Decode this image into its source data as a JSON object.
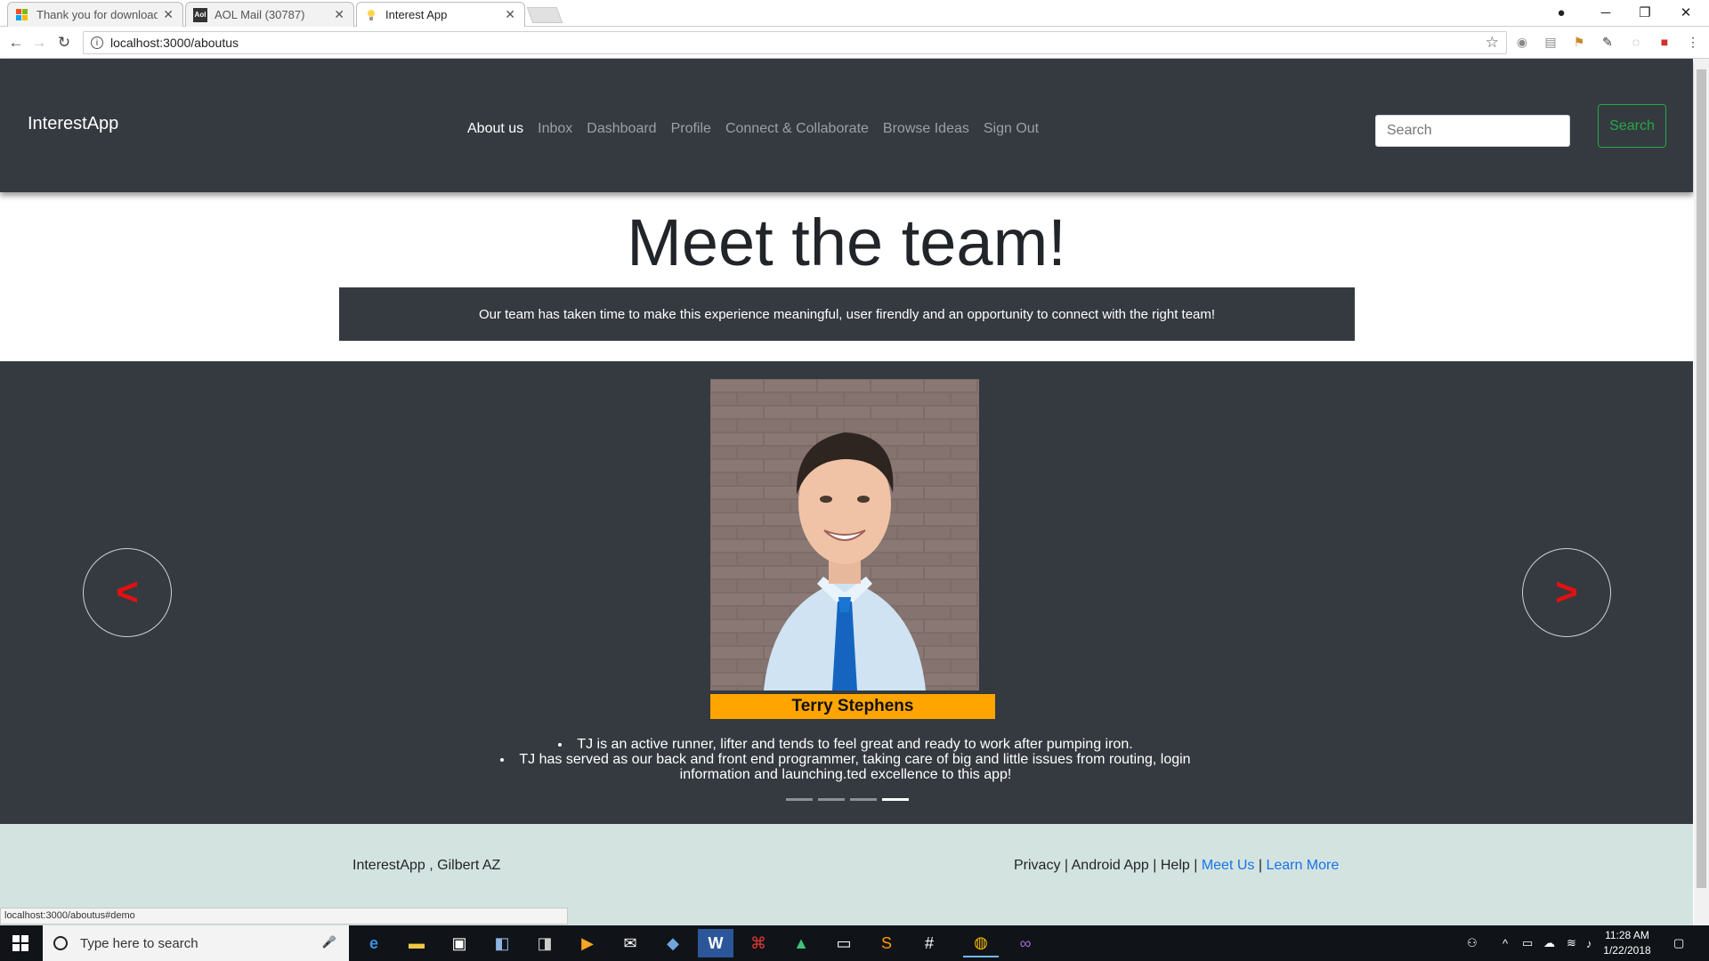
{
  "browser": {
    "tabs": [
      {
        "title": "Thank you for download",
        "active": false
      },
      {
        "title": "AOL Mail (30787)",
        "active": false
      },
      {
        "title": "Interest App",
        "active": true
      }
    ],
    "url": "localhost:3000/aboutus",
    "status_url": "localhost:3000/aboutus#demo",
    "icons": {
      "back": "back-arrow-icon",
      "forward": "forward-arrow-icon",
      "reload": "reload-icon",
      "star": "bookmark-star-icon"
    }
  },
  "navbar": {
    "brand": "InterestApp",
    "links": [
      {
        "label": "About us",
        "active": true
      },
      {
        "label": "Inbox",
        "active": false
      },
      {
        "label": "Dashboard",
        "active": false
      },
      {
        "label": "Profile",
        "active": false
      },
      {
        "label": "Connect & Collaborate",
        "active": false
      },
      {
        "label": "Browse Ideas",
        "active": false
      },
      {
        "label": "Sign Out",
        "active": false
      }
    ],
    "search_placeholder": "Search",
    "search_button": "Search"
  },
  "hero": {
    "title": "Meet the team!",
    "subtitle": "Our team has taken time to make this experience meaningful, user firendly and an opportunity to connect with the right team!"
  },
  "carousel": {
    "prev_label": "<",
    "next_label": ">",
    "member_name": "Terry Stephens",
    "bio": [
      "TJ is an active runner, lifter and tends to feel great and ready to work after pumping iron.",
      "TJ has served as our back and front end programmer, taking care of big and little issues from routing, login information and launching.ted excellence to this app!"
    ],
    "slide_count": 4,
    "active_slide": 4
  },
  "footer": {
    "left": "InterestApp , Gilbert AZ",
    "privacy": "Privacy",
    "android": "Android App",
    "help": "Help",
    "meet": "Meet Us",
    "learn": "Learn More",
    "sep": " | "
  },
  "taskbar": {
    "search_placeholder": "Type here to search",
    "time": "11:28 AM",
    "date": "1/22/2018"
  },
  "colors": {
    "navbar_bg": "#343a40",
    "accent_green": "#28a745",
    "name_bar": "#ffa500",
    "arrow_red": "#e31010",
    "footer_bg": "#d3e4e0",
    "link_blue": "#1a73e8"
  }
}
